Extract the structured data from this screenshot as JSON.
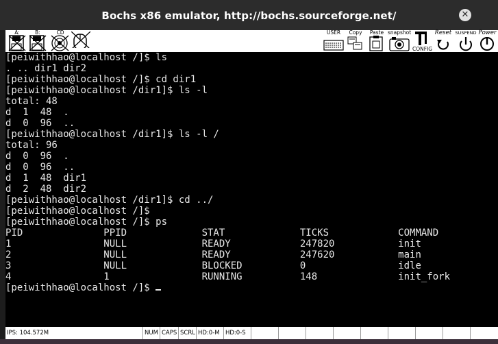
{
  "window": {
    "title": "Bochs x86 emulator, http://bochs.sourceforge.net/"
  },
  "toolbar": {
    "floppy_a": "A:",
    "floppy_b": "B:",
    "cdrom": "CD",
    "user": "USER",
    "copy": "Copy",
    "paste": "Paste",
    "snapshot": "snapshot",
    "config": "CONFIG",
    "reset": "Reset",
    "suspend": "SUSPEND",
    "power": "Power"
  },
  "console": {
    "lines": [
      "[peiwithhao@localhost /]$ ls",
      ". .. dir1 dir2",
      "[peiwithhao@localhost /]$ cd dir1",
      "[peiwithhao@localhost /dir1]$ ls -l",
      "total: 48",
      "d  1  48  .",
      "d  0  96  ..",
      "[peiwithhao@localhost /dir1]$ ls -l /",
      "total: 96",
      "d  0  96  .",
      "d  0  96  ..",
      "d  1  48  dir1",
      "d  2  48  dir2",
      "[peiwithhao@localhost /dir1]$ cd ../",
      "[peiwithhao@localhost /]$",
      "[peiwithhao@localhost /]$ ps",
      "PID              PPID             STAT             TICKS            COMMAND",
      "1                NULL             READY            247820           init",
      "2                NULL             READY            247620           main",
      "3                NULL             BLOCKED          0                idle",
      "4                1                RUNNING          148              init_fork"
    ],
    "prompt": "[peiwithhao@localhost /]$ "
  },
  "status": {
    "ips": "IPS: 104.572M",
    "num": "NUM",
    "caps": "CAPS",
    "scrl": "SCRL",
    "hd0m": "HD:0-M",
    "hd0s": "HD:0-S"
  }
}
